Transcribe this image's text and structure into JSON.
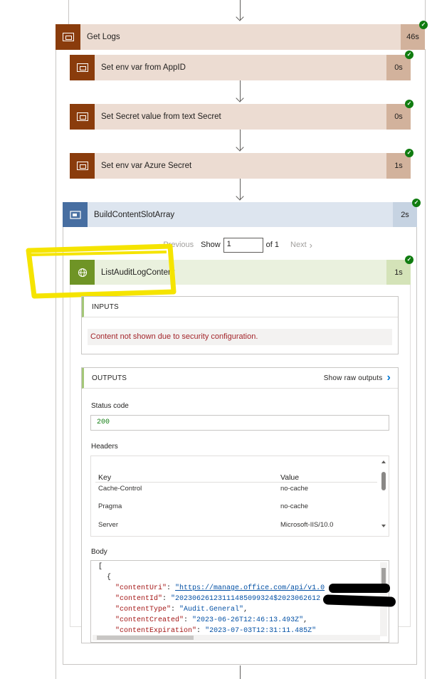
{
  "get_logs": {
    "title": "Get Logs",
    "duration": "46s"
  },
  "steps": [
    {
      "title": "Set env var from AppID",
      "duration": "0s"
    },
    {
      "title": "Set Secret value from text Secret",
      "duration": "0s"
    },
    {
      "title": "Set env var Azure Secret",
      "duration": "1s"
    }
  ],
  "build": {
    "title": "BuildContentSlotArray",
    "duration": "2s"
  },
  "pager": {
    "previous": "Previous",
    "show": "Show",
    "value": "1",
    "of": "of 1",
    "next": "Next"
  },
  "list_audit": {
    "title": "ListAuditLogContent",
    "duration": "1s"
  },
  "inputs": {
    "header": "INPUTS",
    "message": "Content not shown due to security configuration."
  },
  "outputs": {
    "header": "OUTPUTS",
    "show_raw": "Show raw outputs",
    "status_label": "Status code",
    "status_value": "200",
    "headers_label": "Headers",
    "headers_columns": [
      "Key",
      "Value"
    ],
    "headers_rows": [
      {
        "key": "Cache-Control",
        "value": "no-cache"
      },
      {
        "key": "Pragma",
        "value": "no-cache"
      },
      {
        "key": "Server",
        "value": "Microsoft-IIS/10.0"
      }
    ],
    "body_label": "Body",
    "body": {
      "open_bracket": "[",
      "open_brace": "{",
      "k_uri": "\"contentUri\"",
      "v_uri": "\"https://manage.office.com/api/v1.0",
      "k_id": "\"contentId\"",
      "v_id": "\"20230626123111485099324$2023062612",
      "k_type": "\"contentType\"",
      "v_type": "\"Audit.General\"",
      "k_created": "\"contentCreated\"",
      "v_created": "\"2023-06-26T12:46:13.493Z\"",
      "k_exp": "\"contentExpiration\"",
      "v_exp": "\"2023-07-03T12:31:11.485Z\""
    }
  },
  "colors": {
    "brown_accent": "#8a3c0c",
    "brown_bg": "#ecdcd2",
    "brown_duration": "#d2b29c",
    "scope_blue": "#476ea1",
    "scope_bg": "#dde5ef",
    "scope_duration": "#c6d3e2",
    "http_green": "#6f9426",
    "http_bg": "#eaf1de",
    "http_duration": "#d4e3b8",
    "success": "#107c10",
    "error_text": "#a4262c",
    "highlight_yellow": "#f5e400"
  },
  "icons": {
    "step": "scope-window-icon",
    "build": "variable-icon",
    "http": "globe-icon",
    "status": "checkmark-icon",
    "previous": "chevron-left-icon",
    "next": "chevron-right-icon",
    "show_raw": "chevron-right-icon"
  }
}
